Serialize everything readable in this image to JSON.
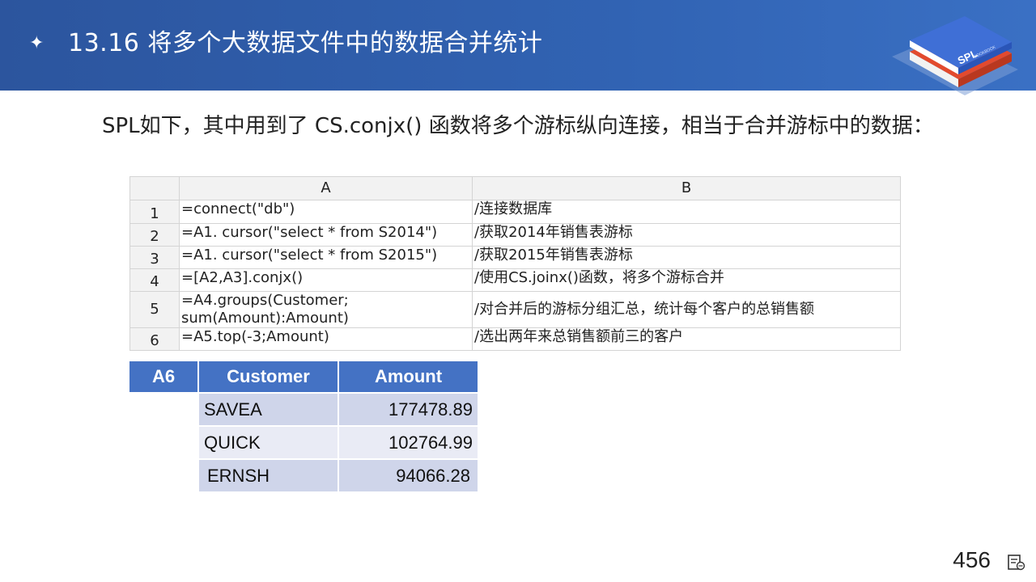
{
  "header": {
    "bullet": "✦",
    "title": "13.16 将多个大数据文件中的数据合并统计",
    "logo": {
      "text": "SPL",
      "subtext": "COOKBOOK",
      "colors": {
        "top": "#3f6fd6",
        "middle": "#e24a2e",
        "shadow": "#7e9fd6"
      }
    }
  },
  "intro": "SPL如下，其中用到了 CS.conjx() 函数将多个游标纵向连接，相当于合并游标中的数据：",
  "spreadsheet": {
    "columns": [
      "A",
      "B"
    ],
    "rows": [
      {
        "n": "1",
        "a": "=connect(\"db\")",
        "b": "/连接数据库"
      },
      {
        "n": "2",
        "a": "=A1. cursor(\"select * from S2014\")",
        "b": "/获取2014年销售表游标"
      },
      {
        "n": "3",
        "a": "=A1. cursor(\"select * from S2015\")",
        "b": "/获取2015年销售表游标"
      },
      {
        "n": "4",
        "a": "=[A2,A3].conjx()",
        "b": "/使用CS.joinx()函数，将多个游标合并"
      },
      {
        "n": "5",
        "a": "=A4.groups(Customer;\nsum(Amount):Amount)",
        "b": "/对合并后的游标分组汇总，统计每个客户的总销售额"
      },
      {
        "n": "6",
        "a": "=A5.top(-3;Amount)",
        "b": "/选出两年来总销售额前三的客户"
      }
    ]
  },
  "result": {
    "cell": "A6",
    "headers": [
      "Customer",
      "Amount"
    ],
    "rows": [
      {
        "customer": "SAVEA",
        "amount": "177478.89"
      },
      {
        "customer": "QUICK",
        "amount": "102764.99"
      },
      {
        "customer": "ERNSH",
        "amount": "94066.28"
      }
    ],
    "header_color": "#4472c4",
    "row_colors": [
      "#cfd5ea",
      "#e9ebf5"
    ]
  },
  "footer": {
    "page_number": "456",
    "icon": "notes-icon"
  }
}
